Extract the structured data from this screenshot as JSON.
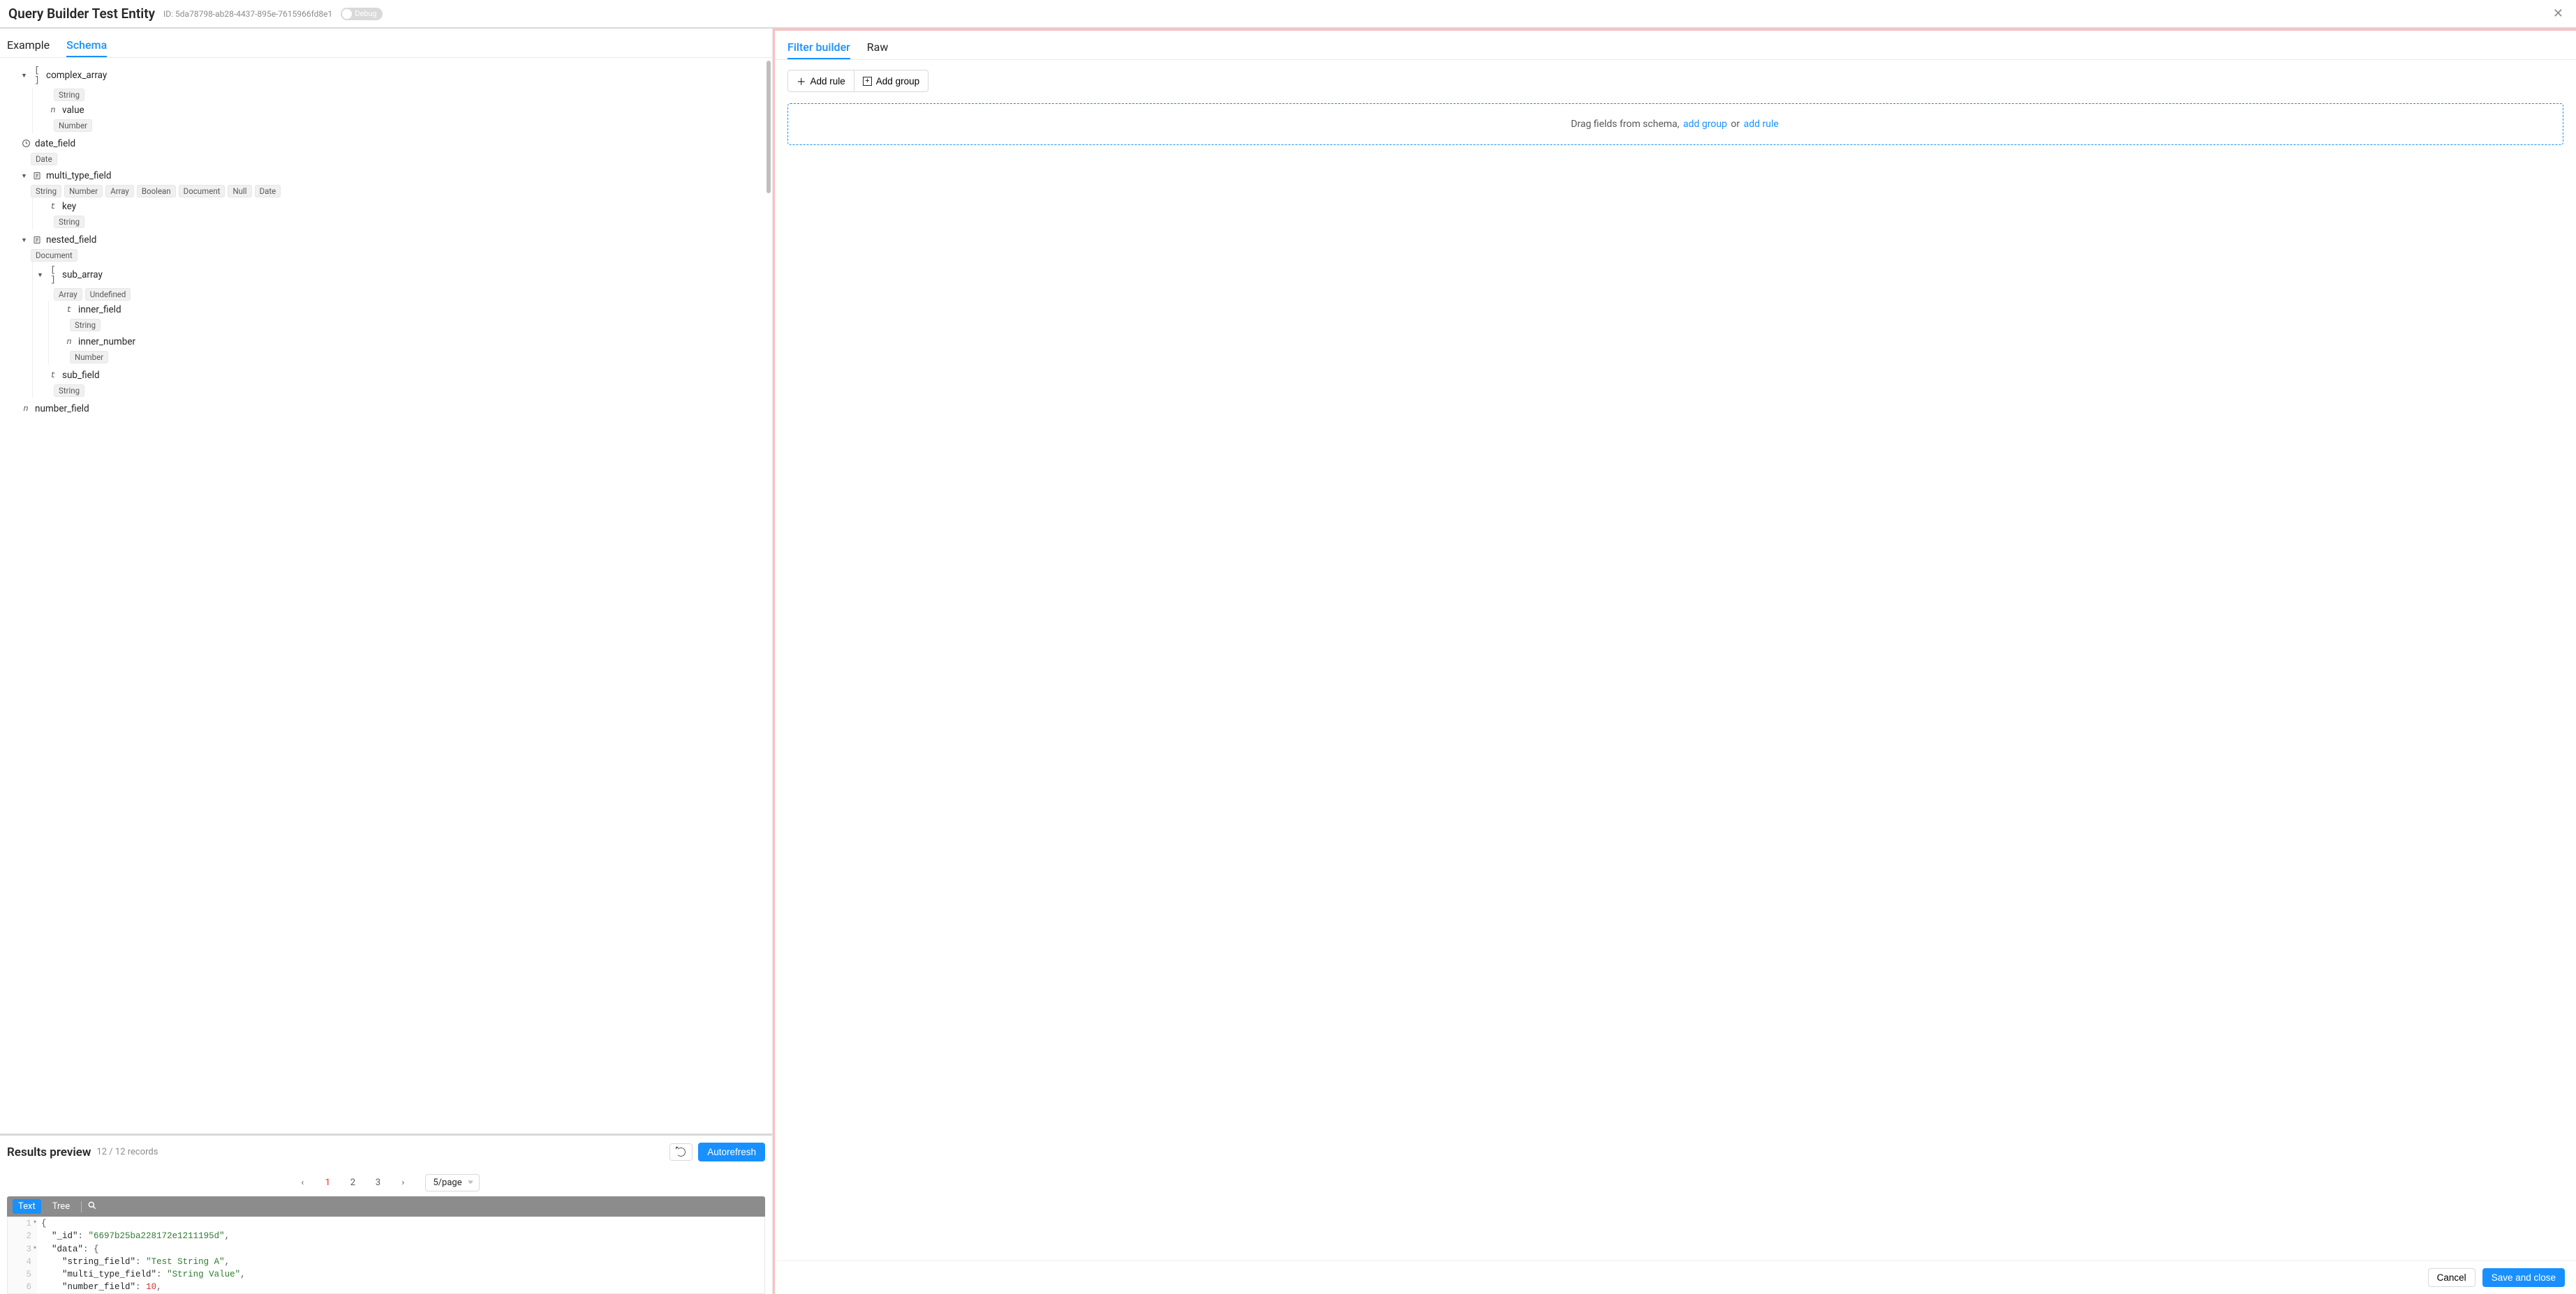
{
  "titlebar": {
    "title": "Query Builder Test Entity",
    "id_prefix": "ID:",
    "id": "5da78798-ab28-4437-895e-7615966fd8e1",
    "debug": "Debug"
  },
  "left_tabs": {
    "example": "Example",
    "schema": "Schema"
  },
  "schema": {
    "complex_array": {
      "name": "complex_array",
      "value_name": "value",
      "value_tag": "Number",
      "top_tag": "String"
    },
    "date_field": {
      "name": "date_field",
      "tag": "Date"
    },
    "multi_type_field": {
      "name": "multi_type_field",
      "tags": [
        "String",
        "Number",
        "Array",
        "Boolean",
        "Document",
        "Null",
        "Date"
      ],
      "key_name": "key",
      "key_tag": "String"
    },
    "nested_field": {
      "name": "nested_field",
      "tag": "Document",
      "sub_array": {
        "name": "sub_array",
        "tags": [
          "Array",
          "Undefined"
        ],
        "inner_field": {
          "name": "inner_field",
          "tag": "String"
        },
        "inner_number": {
          "name": "inner_number",
          "tag": "Number"
        }
      },
      "sub_field": {
        "name": "sub_field",
        "tag": "String"
      }
    },
    "number_field": {
      "name": "number_field"
    }
  },
  "results": {
    "title": "Results preview",
    "count": "12 / 12 records",
    "autorefresh": "Autorefresh",
    "pages": [
      "1",
      "2",
      "3"
    ],
    "page_size": "5/page",
    "toolbar": {
      "text": "Text",
      "tree": "Tree"
    },
    "code": {
      "l1": "{",
      "l2_key": "\"_id\"",
      "l2_val": "\"6697b25ba228172e1211195d\"",
      "l3_key": "\"data\"",
      "l4_key": "\"string_field\"",
      "l4_val": "\"Test String A\"",
      "l5_key": "\"multi_type_field\"",
      "l5_val": "\"String Value\"",
      "l6_key": "\"number_field\"",
      "l6_val": "10"
    }
  },
  "right_tabs": {
    "filter": "Filter builder",
    "raw": "Raw"
  },
  "filter": {
    "add_rule": "Add rule",
    "add_group": "Add group",
    "drop_prefix": "Drag fields from schema, ",
    "drop_link1": "add group",
    "drop_mid": " or ",
    "drop_link2": "add rule"
  },
  "footer": {
    "cancel": "Cancel",
    "save": "Save and close"
  }
}
